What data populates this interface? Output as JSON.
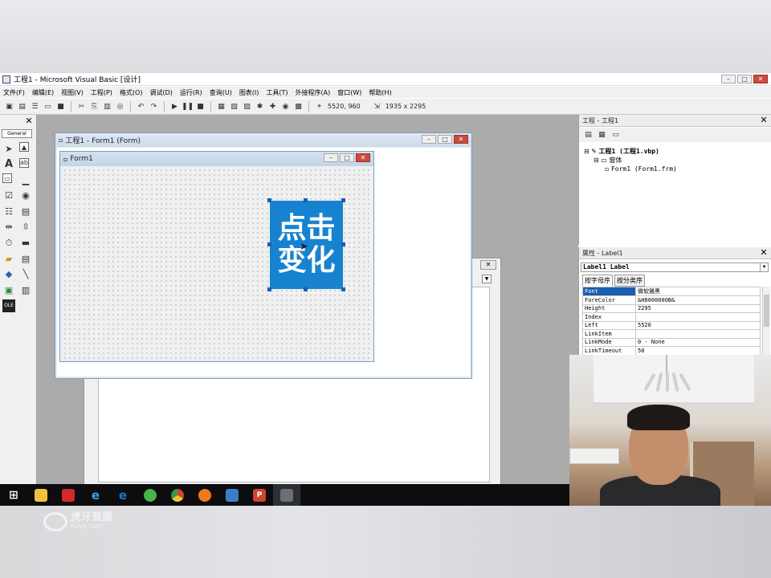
{
  "app": {
    "title": "工程1 - Microsoft Visual Basic [设计]"
  },
  "menu": [
    "文件(F)",
    "编辑(E)",
    "视图(V)",
    "工程(P)",
    "格式(O)",
    "调试(D)",
    "运行(R)",
    "查询(U)",
    "图表(I)",
    "工具(T)",
    "外接程序(A)",
    "窗口(W)",
    "帮助(H)"
  ],
  "toolbar": {
    "position_readout": "5520, 960",
    "size_readout": "1935 x 2295"
  },
  "toolbox": {
    "tab_label": "General",
    "tools": [
      "pointer-icon",
      "picturebox-icon",
      "label-icon",
      "textbox-icon",
      "frame-icon",
      "commandbutton-icon",
      "checkbox-icon",
      "optionbutton-icon",
      "combobox-icon",
      "listbox-icon",
      "hscrollbar-icon",
      "vscrollbar-icon",
      "timer-icon",
      "drivelistbox-icon",
      "dirlistbox-icon",
      "filelistbox-icon",
      "shape-icon",
      "line-icon",
      "image-icon",
      "data-icon",
      "ole-icon"
    ]
  },
  "form_window": {
    "title": "工程1 - Form1 (Form)"
  },
  "form1": {
    "title": "Form1"
  },
  "label1": {
    "caption": "点击变化",
    "back_color": "#1783d0"
  },
  "project_panel": {
    "title": "工程 - 工程1",
    "tree": {
      "project": "工程1 (工程1.vbp)",
      "folder": "窗体",
      "form": "Form1 (Form1.frm)"
    }
  },
  "properties_panel": {
    "title": "属性 - Label1",
    "object": "Label1 Label",
    "tabs": [
      "按字母序",
      "按分类序"
    ],
    "rows": [
      {
        "name": "Font",
        "value": "微软雅黑"
      },
      {
        "name": "ForeColor",
        "value": "&H8000000B&"
      },
      {
        "name": "Height",
        "value": "2295"
      },
      {
        "name": "Index",
        "value": ""
      },
      {
        "name": "Left",
        "value": "5520"
      },
      {
        "name": "LinkItem",
        "value": ""
      },
      {
        "name": "LinkMode",
        "value": "0 - None"
      },
      {
        "name": "LinkTimeout",
        "value": "50"
      }
    ]
  },
  "taskbar": {
    "items": [
      "windows-start-icon",
      "file-explorer-icon",
      "app-icon",
      "ie-icon",
      "edge-icon",
      "360-browser-icon",
      "chrome-icon",
      "firefox-icon",
      "remote-desktop-icon",
      "powerpoint-icon",
      "vb6-icon"
    ]
  },
  "watermark": {
    "brand": "虎牙直播",
    "domain": "huya.com"
  }
}
